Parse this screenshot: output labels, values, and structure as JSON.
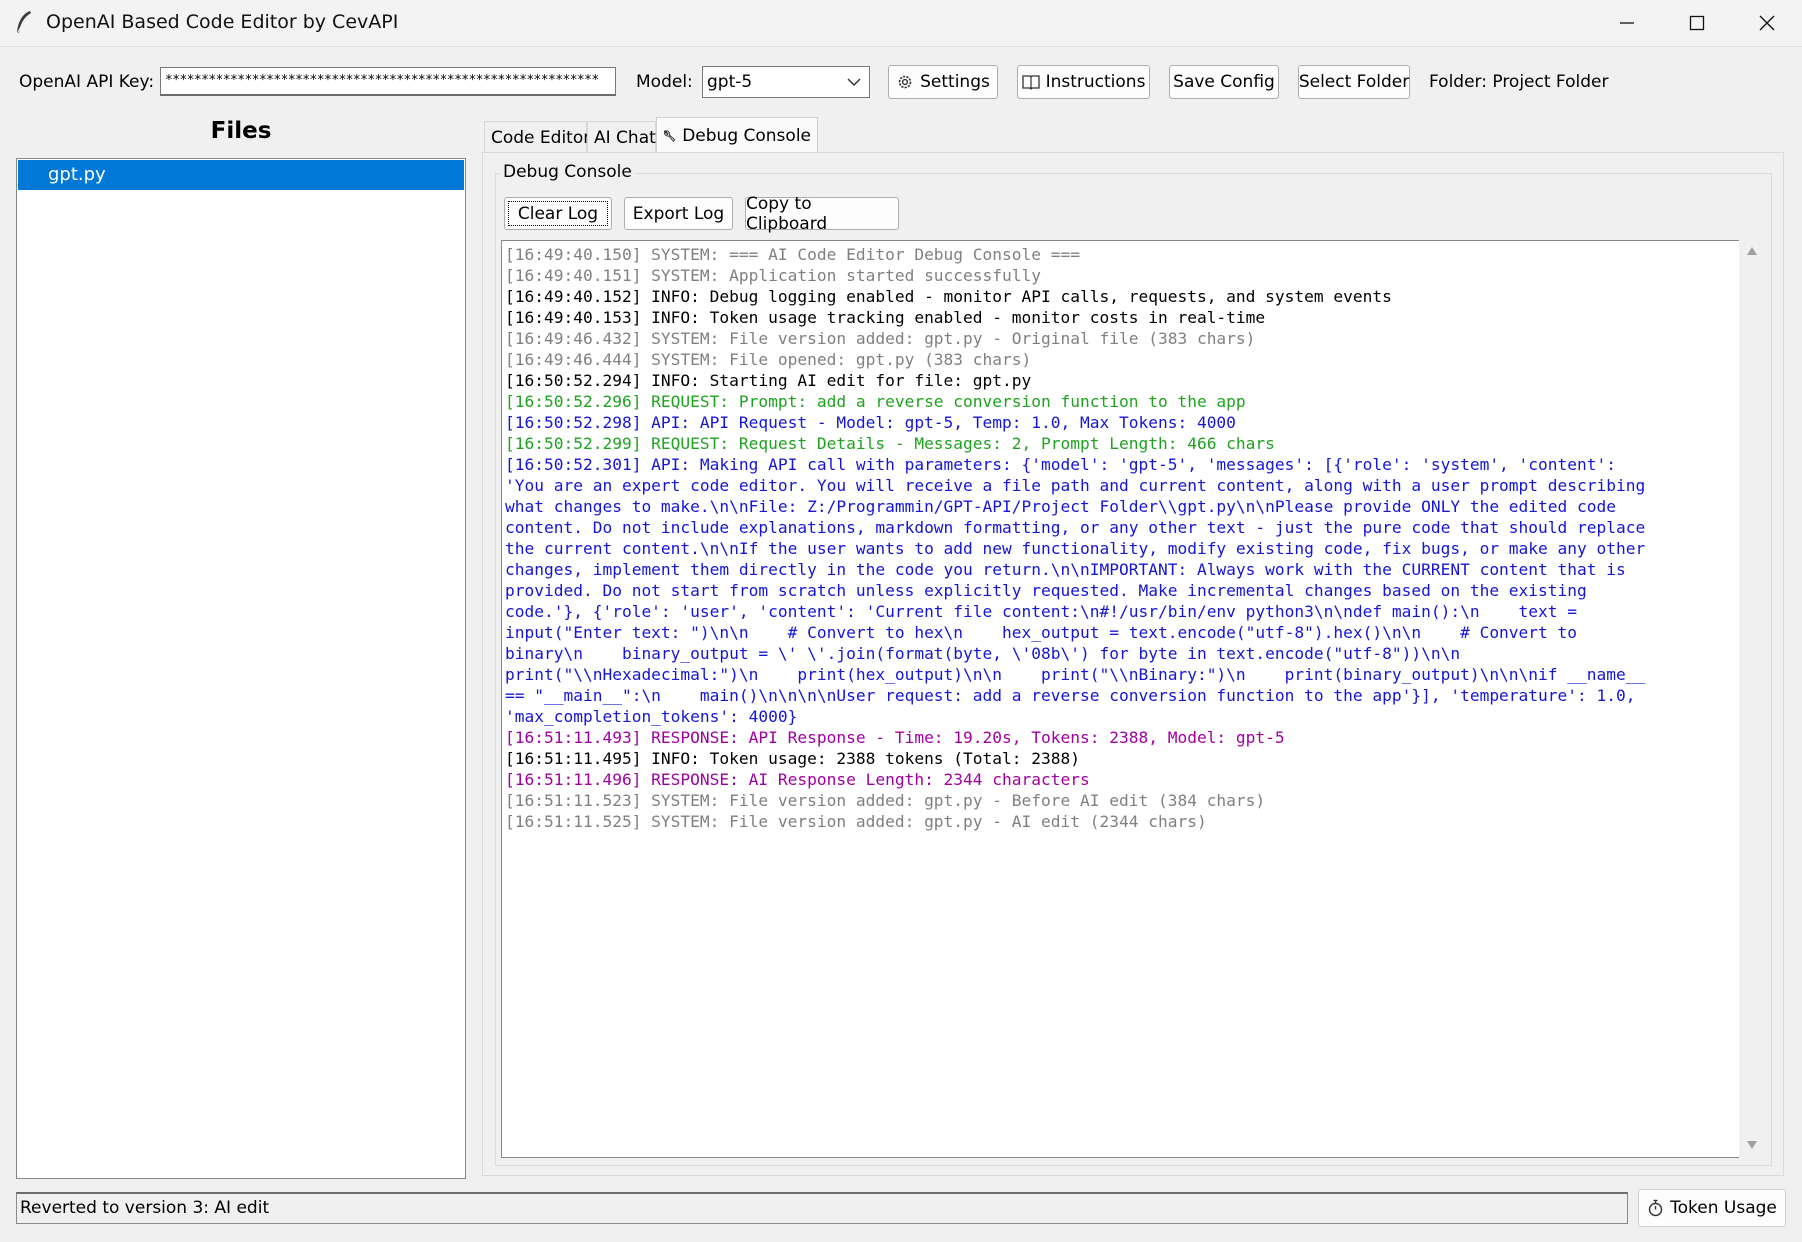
{
  "window": {
    "title": "OpenAI Based Code Editor by CevAPI"
  },
  "toolbar": {
    "api_key_label": "OpenAI API Key:",
    "api_key_value": "************************************************************",
    "model_label": "Model:",
    "model_value": "gpt-5",
    "settings_label": "Settings",
    "instructions_label": "Instructions",
    "save_config_label": "Save Config",
    "select_folder_label": "Select Folder",
    "folder_text": "Folder: Project Folder"
  },
  "files": {
    "title": "Files",
    "items": [
      "gpt.py"
    ]
  },
  "tabs": [
    "Code Editor",
    "AI Chat",
    "Debug Console"
  ],
  "debug": {
    "group_label": "Debug Console",
    "clear_label": "Clear Log",
    "export_label": "Export Log",
    "copy_label": "Copy to Clipboard",
    "log_lines": [
      {
        "level": "system",
        "text": "[16:49:40.150] SYSTEM: === AI Code Editor Debug Console ==="
      },
      {
        "level": "system",
        "text": "[16:49:40.151] SYSTEM: Application started successfully"
      },
      {
        "level": "info",
        "text": "[16:49:40.152] INFO: Debug logging enabled - monitor API calls, requests, and system events"
      },
      {
        "level": "info",
        "text": "[16:49:40.153] INFO: Token usage tracking enabled - monitor costs in real-time"
      },
      {
        "level": "system",
        "text": "[16:49:46.432] SYSTEM: File version added: gpt.py - Original file (383 chars)"
      },
      {
        "level": "system",
        "text": "[16:49:46.444] SYSTEM: File opened: gpt.py (383 chars)"
      },
      {
        "level": "info",
        "text": "[16:50:52.294] INFO: Starting AI edit for file: gpt.py"
      },
      {
        "level": "request",
        "text": "[16:50:52.296] REQUEST: Prompt: add a reverse conversion function to the app"
      },
      {
        "level": "api",
        "text": "[16:50:52.298] API: API Request - Model: gpt-5, Temp: 1.0, Max Tokens: 4000"
      },
      {
        "level": "request",
        "text": "[16:50:52.299] REQUEST: Request Details - Messages: 2, Prompt Length: 466 chars"
      },
      {
        "level": "api",
        "text": "[16:50:52.301] API: Making API call with parameters: {'model': 'gpt-5', 'messages': [{'role': 'system', 'content': \n'You are an expert code editor. You will receive a file path and current content, along with a user prompt describing \nwhat changes to make.\\n\\nFile: Z:/Programmin/GPT-API/Project Folder\\\\gpt.py\\n\\nPlease provide ONLY the edited code \ncontent. Do not include explanations, markdown formatting, or any other text - just the pure code that should replace \nthe current content.\\n\\nIf the user wants to add new functionality, modify existing code, fix bugs, or make any other \nchanges, implement them directly in the code you return.\\n\\nIMPORTANT: Always work with the CURRENT content that is \nprovided. Do not start from scratch unless explicitly requested. Make incremental changes based on the existing \ncode.'}, {'role': 'user', 'content': 'Current file content:\\n#!/usr/bin/env python3\\n\\ndef main():\\n    text = \ninput(\"Enter text: \")\\n\\n    # Convert to hex\\n    hex_output = text.encode(\"utf-8\").hex()\\n\\n    # Convert to \nbinary\\n    binary_output = \\' \\'.join(format(byte, \\'08b\\') for byte in text.encode(\"utf-8\"))\\n\\n    \nprint(\"\\\\nHexadecimal:\")\\n    print(hex_output)\\n\\n    print(\"\\\\nBinary:\")\\n    print(binary_output)\\n\\n\\nif __name__\n== \"__main__\":\\n    main()\\n\\n\\n\\nUser request: add a reverse conversion function to the app'}], 'temperature': 1.0, \n'max_completion_tokens': 4000}"
      },
      {
        "level": "response",
        "text": "[16:51:11.493] RESPONSE: API Response - Time: 19.20s, Tokens: 2388, Model: gpt-5"
      },
      {
        "level": "info",
        "text": "[16:51:11.495] INFO: Token usage: 2388 tokens (Total: 2388)"
      },
      {
        "level": "response",
        "text": "[16:51:11.496] RESPONSE: AI Response Length: 2344 characters"
      },
      {
        "level": "system",
        "text": "[16:51:11.523] SYSTEM: File version added: gpt.py - Before AI edit (384 chars)"
      },
      {
        "level": "system",
        "text": "[16:51:11.525] SYSTEM: File version added: gpt.py - AI edit (2344 chars)"
      }
    ]
  },
  "status": {
    "text": "Reverted to version 3: AI edit",
    "token_usage_label": "Token Usage"
  },
  "colors": {
    "selection": "#0078d7",
    "system": "#808080",
    "info": "#000000",
    "request": "#1fa31f",
    "api": "#1515d9",
    "response": "#a100a1"
  },
  "icons": [
    "feather-icon",
    "minimize-icon",
    "maximize-icon",
    "close-icon",
    "chevron-down-icon",
    "gear-icon",
    "book-icon",
    "wrench-icon",
    "stopwatch-icon",
    "scroll-up-arrow-icon",
    "scroll-down-arrow-icon"
  ]
}
